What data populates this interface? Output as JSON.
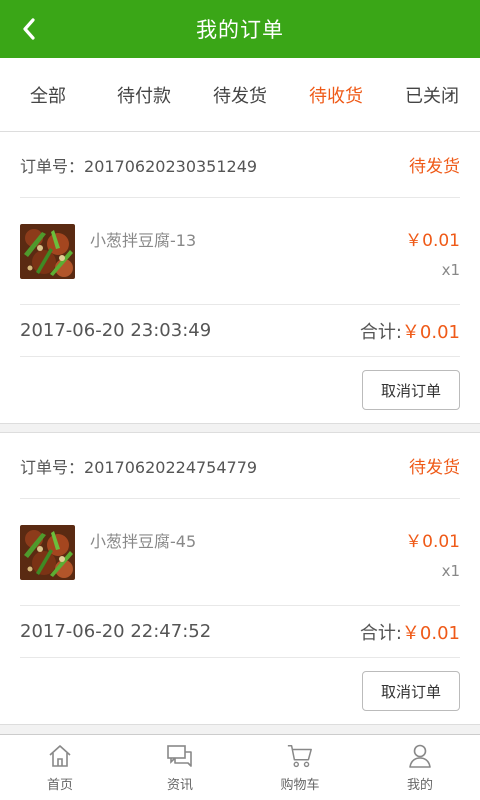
{
  "header": {
    "title": "我的订单",
    "back_icon": "chevron-left-icon"
  },
  "tabs": [
    {
      "label": "全部",
      "active": false
    },
    {
      "label": "待付款",
      "active": false
    },
    {
      "label": "待发货",
      "active": false
    },
    {
      "label": "待收货",
      "active": true
    },
    {
      "label": "已关闭",
      "active": false
    }
  ],
  "orders": [
    {
      "order_no_label": "订单号：",
      "order_no": "20170620230351249",
      "status": "待发货",
      "item": {
        "name": "小葱拌豆腐-13",
        "price": "￥0.01",
        "qty": "x1"
      },
      "time": "2017-06-20 23:03:49",
      "total_label": "合计:",
      "total": "￥0.01",
      "action": "取消订单"
    },
    {
      "order_no_label": "订单号：",
      "order_no": "20170620224754779",
      "status": "待发货",
      "item": {
        "name": "小葱拌豆腐-45",
        "price": "￥0.01",
        "qty": "x1"
      },
      "time": "2017-06-20 22:47:52",
      "total_label": "合计:",
      "total": "￥0.01",
      "action": "取消订单"
    }
  ],
  "bottom_nav": [
    {
      "label": "首页",
      "icon": "home-icon"
    },
    {
      "label": "资讯",
      "icon": "chat-icon"
    },
    {
      "label": "购物车",
      "icon": "cart-icon"
    },
    {
      "label": "我的",
      "icon": "user-icon"
    }
  ],
  "colors": {
    "header": "#3aa617",
    "accent": "#ef5a18",
    "text": "#555555"
  }
}
